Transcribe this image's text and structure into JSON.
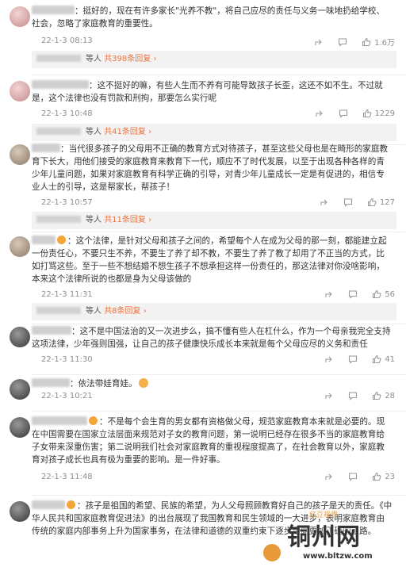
{
  "comments": [
    {
      "text": "挺好的，现在有许多家长\"光养不教\"，将自己应尽的责任与义务一味地扔给学校、社会，忽略了家庭教育的重要性。",
      "time": "22-1-3 08:13",
      "likes": "1.6万",
      "replies": {
        "suffix": "等人",
        "count": "共398条回复"
      }
    },
    {
      "text": "这不挺好的嘛，有些人生而不养有可能导致孩子长歪，这还不如不生。不过就是，这个法律也没有罚款和刑拘，那要怎么实行呢",
      "time": "22-1-3 10:48",
      "likes": "1229",
      "replies": {
        "suffix": "等人",
        "count": "共41条回复"
      }
    },
    {
      "text": "当代很多孩子的父母用不正确的教育方式对待孩子，甚至这些父母也是在畸形的家庭教育下长大，用他们接受的家庭教育来教育下一代，顺应不了时代发展，以至于出现各种各样的青少年儿童问题，如果对家庭教育有科学正确的引导，对青少年儿童成长一定是有促进的，相信专业人士的引导，这是帮家长，帮孩子！",
      "time": "22-1-3 10:57",
      "likes": "127",
      "replies": {
        "suffix": "等人",
        "count": "共11条回复"
      }
    },
    {
      "text": "这个法律，是针对父母和孩子之间的，希望每个人在成为父母的那一刻，都能建立起一份责任心，不要只生不养，不要生了养了却不教，不要生了养了教了却用了不正当的方式，比如打骂这些。至于一些不想结婚不想生孩子不想承担这样一份责任的，那这法律对你没啥影响，本来这个法律所说的也都是身为父母该做的",
      "time": "22-1-3 11:31",
      "likes": "56",
      "replies": {
        "suffix": "等人",
        "count": "共8条回复"
      }
    },
    {
      "text": "这不是中国法治的又一次进步么，搞不懂有些人在杠什么，作为一个母亲我完全支持这项法律，少年强则国强，让自己的孩子健康快乐成长本来就是每个父母应尽的义务和责任",
      "time": "22-1-3 11:30",
      "likes": "41"
    },
    {
      "text": "依法带娃育娃。",
      "time": "22-1-3 10:21",
      "likes": "28"
    },
    {
      "text": "不是每个会生育的男女都有资格做父母，规范家庭教育本来就是必要的。现在中国需要在国家立法层面来规范对子女的教育问题，第一说明已经存在很多不当的家庭教育给子女带来深重伤害；第二说明我们社会对家庭教育的重视程度提高了，在社会教育以外，家庭教育对孩子成长也具有极为重要的影响。是一件好事。",
      "time": "22-1-3 11:48",
      "likes": "23"
    },
    {
      "text": "孩子是祖国的希望、民族的希望，为人父母照顾教育好自己的孩子是天的责任。《中华人民共和国家庭教育促进法》的出台展现了我国教育和民生领域的一大进步，表明家庭教育由传统的家庭内部事务上升为国家事务，在法律和道德的双重约束下逐步走向更加正确的道路。"
    }
  ],
  "watermark": {
    "title": "铜州网",
    "url": "www.bltzw.com",
    "small": "红豆视界"
  },
  "colors": {
    "accent": "#eb7340",
    "meta": "#8e8e8e",
    "reply_bg": "#f2f2f2"
  },
  "icons": [
    "share-icon",
    "comment-icon",
    "like-icon"
  ]
}
